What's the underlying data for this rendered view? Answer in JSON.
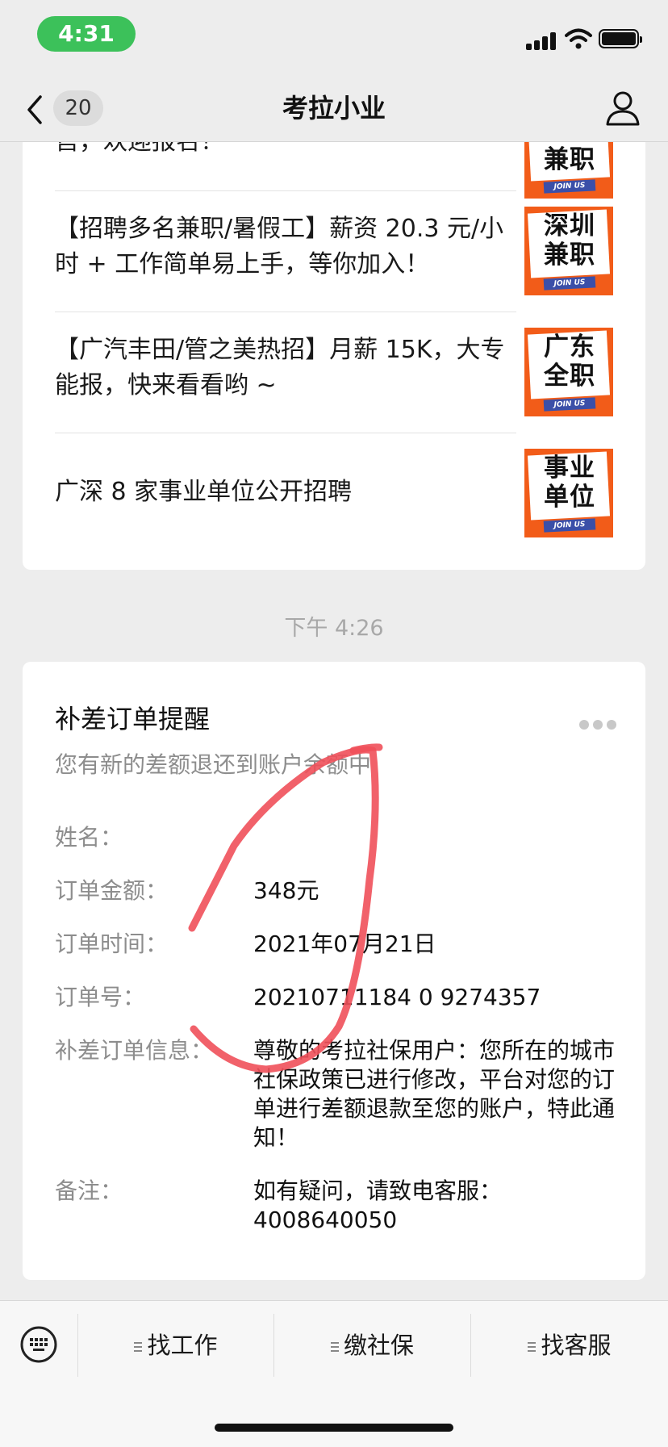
{
  "status_bar": {
    "time": "4:31"
  },
  "nav": {
    "unread_count": "20",
    "title": "考拉小业"
  },
  "articles": [
    {
      "text": "售，欢迎报名！",
      "thumb": "兼职"
    },
    {
      "text": "【招聘多名兼职/暑假工】薪资 20.3 元/小时 + 工作简单易上手，等你加入！",
      "thumb": "深圳兼职"
    },
    {
      "text": "【广汽丰田/管之美热招】月薪 15K，大专能报，快来看看哟 ~",
      "thumb": "广东全职"
    },
    {
      "text": "广深 8 家事业单位公开招聘",
      "thumb": "事业单位"
    }
  ],
  "thumb_badge": "JOIN US",
  "timestamp": "下午 4:26",
  "notice": {
    "title": "补差订单提醒",
    "subtitle": "您有新的差额退还到账户余额中",
    "rows": [
      {
        "label": "姓名：",
        "value": ""
      },
      {
        "label": "订单金额：",
        "value": "348元"
      },
      {
        "label": "订单时间：",
        "value": "2021年07月21日"
      },
      {
        "label": "订单号：",
        "value": "20210711184 0 9274357"
      },
      {
        "label": "补差订单信息：",
        "value": "尊敬的考拉社保用户：您所在的城市社保政策已进行修改，平台对您的订单进行差额退款至您的账户，特此通知！"
      },
      {
        "label": "备注：",
        "value": "如有疑问，请致电客服：4008640050"
      }
    ]
  },
  "menu": {
    "items": [
      "找工作",
      "缴社保",
      "找客服"
    ]
  },
  "colors": {
    "status_pill": "#3cc15a",
    "thumb_orange": "#f25c19",
    "scribble": "#f0505a"
  }
}
